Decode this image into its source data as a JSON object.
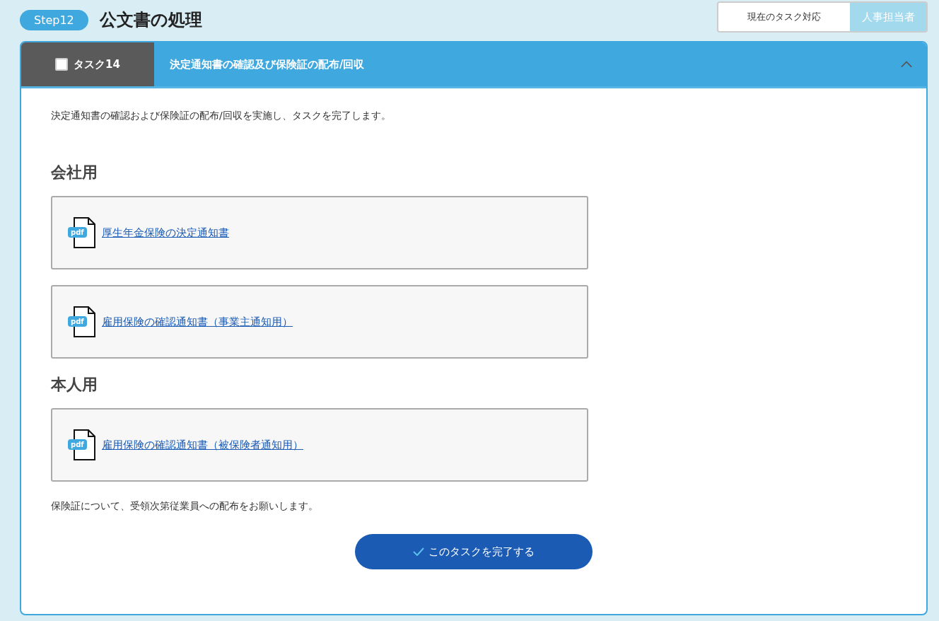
{
  "step": {
    "badge": "Step12",
    "title": "公文書の処理"
  },
  "role": {
    "label": "現在のタスク対応",
    "value": "人事担当者"
  },
  "task": {
    "checked": false,
    "number": "タスク14",
    "title": "決定通知書の確認及び保険証の配布/回収",
    "expanded": true,
    "description": "決定通知書の確認および保険証の配布/回収を実施し、タスクを完了します。",
    "sections": [
      {
        "heading": "会社用",
        "documents": [
          {
            "badge": "pdf",
            "link": "厚生年金保険の決定通知書"
          },
          {
            "badge": "pdf",
            "link": "雇用保険の確認通知書（事業主通知用）"
          }
        ]
      },
      {
        "heading": "本人用",
        "documents": [
          {
            "badge": "pdf",
            "link": "雇用保険の確認通知書（被保険者通知用）"
          }
        ]
      }
    ],
    "note": "保険証について、受領次第従業員への配布をお願いします。",
    "complete_button": "このタスクを完了する"
  }
}
